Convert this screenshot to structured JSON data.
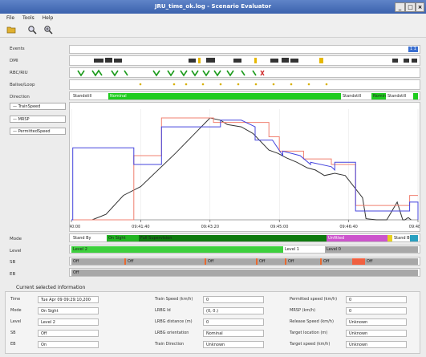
{
  "window": {
    "title": "JRU_time_ok.log - Scenario Evaluator"
  },
  "menu": {
    "file": "File",
    "tools": "Tools",
    "help": "Help"
  },
  "toolbar": {
    "open_icon": "folder-open-icon",
    "zoom_icon": "magnifier-icon",
    "zoom_in_icon": "magnifier-plus-icon"
  },
  "rows": {
    "events": "Events",
    "dmi": "DMI",
    "rbc": "RBC/RIU",
    "balise": "Balise/Loop",
    "direction": "Direction",
    "mode": "Mode",
    "level": "Level",
    "sb": "SB",
    "eb": "EB"
  },
  "legend": {
    "train_speed": "TrainSpeed",
    "mrsp": "MRSP",
    "permitted_speed": "PermittedSpeed"
  },
  "events_button": "1 1",
  "direction_segments": [
    {
      "label": "Standstill"
    },
    {
      "label": "Nominal"
    },
    {
      "label": "Standstill"
    },
    {
      "label": "Nominal"
    },
    {
      "label": "Standstill"
    }
  ],
  "mode_segments": [
    {
      "label": "Stand By"
    },
    {
      "label": "On Sight"
    },
    {
      "label": "Full Supervision"
    },
    {
      "label": "Unfitted"
    },
    {
      "label": "Stand By"
    }
  ],
  "level_segments": [
    {
      "label": "Level 2"
    },
    {
      "label": "Level 1"
    },
    {
      "label": "Level 0"
    }
  ],
  "sb_segments": [
    "Off",
    "Off",
    "Off",
    "Off",
    "Off",
    "Off",
    "Off"
  ],
  "eb_segments": [
    "Off"
  ],
  "time_axis": {
    "ticks": [
      "09:40:00",
      "09:41:40",
      "09:43:20",
      "09:45:00",
      "09:46:40",
      "09:48:20"
    ]
  },
  "chart_data": {
    "type": "line",
    "title": "",
    "xlabel": "",
    "ylabel": "",
    "x_ticks": [
      "09:40:00",
      "09:41:40",
      "09:43:20",
      "09:45:00",
      "09:46:40",
      "09:48:20"
    ],
    "series": [
      {
        "name": "TrainSpeed",
        "color": "#333333",
        "t_sec": [
          0,
          30,
          50,
          75,
          100,
          150,
          200,
          215,
          225,
          245,
          262,
          285,
          298,
          310,
          325,
          340,
          352,
          365,
          380,
          395,
          420,
          425,
          440,
          455,
          470,
          478,
          481,
          486,
          490
        ],
        "values": [
          0,
          0,
          5,
          22,
          30,
          60,
          92,
          90,
          86,
          84,
          78,
          63,
          60,
          56,
          52,
          47,
          45,
          40,
          42,
          40,
          20,
          1,
          0,
          0,
          16,
          0,
          0,
          2,
          0
        ]
      },
      {
        "name": "MRSP",
        "color": "#f08070",
        "t_sec": [
          0,
          90,
          90,
          130,
          130,
          205,
          205,
          285,
          285,
          300,
          300,
          335,
          335,
          375,
          375,
          410,
          410,
          488,
          488,
          500
        ],
        "values": [
          0,
          0,
          58,
          58,
          92,
          92,
          88,
          88,
          75,
          75,
          62,
          62,
          55,
          55,
          50,
          50,
          13,
          13,
          22,
          22
        ]
      },
      {
        "name": "PermittedSpeed",
        "color": "#4444dd",
        "t_sec": [
          0,
          2,
          2,
          90,
          90,
          130,
          130,
          200,
          215,
          215,
          245,
          265,
          265,
          290,
          305,
          305,
          330,
          345,
          345,
          375,
          380,
          380,
          410,
          410,
          488,
          488,
          500,
          500
        ],
        "values": [
          0,
          0,
          65,
          65,
          50,
          50,
          84,
          84,
          84,
          90,
          90,
          84,
          72,
          72,
          58,
          62,
          58,
          50,
          52,
          48,
          45,
          52,
          52,
          8,
          8,
          16,
          16,
          0
        ]
      }
    ]
  },
  "info": {
    "title": "Current selected information",
    "col1": [
      {
        "label": "Time",
        "value": "Tue Apr 09 09:29:10,200"
      },
      {
        "label": "Mode",
        "value": "On Sight"
      },
      {
        "label": "Level",
        "value": "Level 2"
      },
      {
        "label": "SB",
        "value": "Off"
      },
      {
        "label": "EB",
        "value": "On"
      }
    ],
    "col2": [
      {
        "label": "Train Speed (km/h)",
        "value": "0"
      },
      {
        "label": "LRBG Id",
        "value": "(0, 0.)"
      },
      {
        "label": "LRBG distance (m)",
        "value": "0"
      },
      {
        "label": "LRBG orientation",
        "value": "Nominal"
      },
      {
        "label": "Train Direction",
        "value": "Unknown"
      }
    ],
    "col3": [
      {
        "label": "Permitted speed (km/h)",
        "value": "0"
      },
      {
        "label": "MRSP (km/h)",
        "value": "0"
      },
      {
        "label": "Release Speed (km/h)",
        "value": "Unknown"
      },
      {
        "label": "Target location (m)",
        "value": "Unknown"
      },
      {
        "label": "Target speed (km/h)",
        "value": "Unknown"
      }
    ]
  }
}
